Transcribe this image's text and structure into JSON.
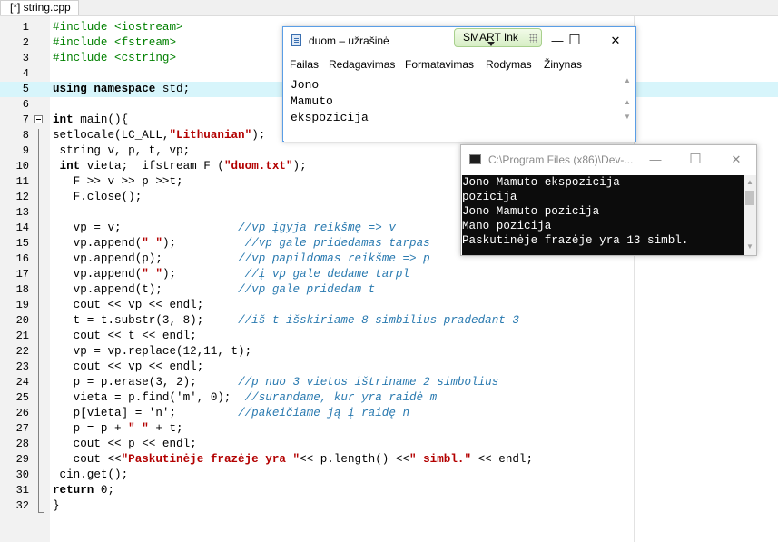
{
  "editor": {
    "tab_label": "[*] string.cpp",
    "lines": [
      {
        "n": "1",
        "segs": [
          {
            "c": "pp",
            "t": "#include <iostream>"
          }
        ]
      },
      {
        "n": "2",
        "segs": [
          {
            "c": "pp",
            "t": "#include <fstream>"
          }
        ]
      },
      {
        "n": "3",
        "segs": [
          {
            "c": "pp",
            "t": "#include <cstring>"
          }
        ]
      },
      {
        "n": "4",
        "segs": []
      },
      {
        "n": "5",
        "hl": true,
        "segs": [
          {
            "c": "kw",
            "t": "using namespace"
          },
          {
            "c": "",
            "t": " std;"
          }
        ]
      },
      {
        "n": "6",
        "segs": []
      },
      {
        "n": "7",
        "fold": true,
        "segs": [
          {
            "c": "kw",
            "t": "int"
          },
          {
            "c": "",
            "t": " main(){"
          }
        ]
      },
      {
        "n": "8",
        "segs": [
          {
            "c": "",
            "t": "setlocale(LC_ALL,"
          },
          {
            "c": "str",
            "t": "\"Lithuanian\""
          },
          {
            "c": "",
            "t": ");"
          }
        ]
      },
      {
        "n": "9",
        "segs": [
          {
            "c": "",
            "t": " string v, p, t, vp;"
          }
        ]
      },
      {
        "n": "10",
        "segs": [
          {
            "c": "",
            "t": " "
          },
          {
            "c": "kw",
            "t": "int"
          },
          {
            "c": "",
            "t": " vieta;  ifstream F ("
          },
          {
            "c": "str",
            "t": "\"duom.txt\""
          },
          {
            "c": "",
            "t": ");"
          }
        ]
      },
      {
        "n": "11",
        "segs": [
          {
            "c": "",
            "t": "   F >> v >> p >>t;"
          }
        ]
      },
      {
        "n": "12",
        "segs": [
          {
            "c": "",
            "t": "   F.close();"
          }
        ]
      },
      {
        "n": "13",
        "segs": []
      },
      {
        "n": "14",
        "segs": [
          {
            "c": "",
            "t": "   vp = v;                 "
          },
          {
            "c": "cmt",
            "t": "//vp įgyja reikšmę => v"
          }
        ]
      },
      {
        "n": "15",
        "segs": [
          {
            "c": "",
            "t": "   vp.append("
          },
          {
            "c": "str",
            "t": "\" \""
          },
          {
            "c": "",
            "t": ");          "
          },
          {
            "c": "cmt",
            "t": "//vp gale pridedamas tarpas"
          }
        ]
      },
      {
        "n": "16",
        "segs": [
          {
            "c": "",
            "t": "   vp.append(p);           "
          },
          {
            "c": "cmt",
            "t": "//vp papildomas reikšme => p"
          }
        ]
      },
      {
        "n": "17",
        "segs": [
          {
            "c": "",
            "t": "   vp.append("
          },
          {
            "c": "str",
            "t": "\" \""
          },
          {
            "c": "",
            "t": ");          "
          },
          {
            "c": "cmt",
            "t": "//į vp gale dedame tarpl"
          }
        ]
      },
      {
        "n": "18",
        "segs": [
          {
            "c": "",
            "t": "   vp.append(t);           "
          },
          {
            "c": "cmt",
            "t": "//vp gale pridedam t"
          }
        ]
      },
      {
        "n": "19",
        "segs": [
          {
            "c": "",
            "t": "   cout << vp << endl;"
          }
        ]
      },
      {
        "n": "20",
        "segs": [
          {
            "c": "",
            "t": "   t = t.substr(3, 8);     "
          },
          {
            "c": "cmt",
            "t": "//iš t išskiriame 8 simbilius pradedant 3"
          }
        ]
      },
      {
        "n": "21",
        "segs": [
          {
            "c": "",
            "t": "   cout << t << endl;"
          }
        ]
      },
      {
        "n": "22",
        "segs": [
          {
            "c": "",
            "t": "   vp = vp.replace(12,11, t);"
          }
        ]
      },
      {
        "n": "23",
        "segs": [
          {
            "c": "",
            "t": "   cout << vp << endl;"
          }
        ]
      },
      {
        "n": "24",
        "segs": [
          {
            "c": "",
            "t": "   p = p.erase(3, 2);      "
          },
          {
            "c": "cmt",
            "t": "//p nuo 3 vietos ištriname 2 simbolius"
          }
        ]
      },
      {
        "n": "25",
        "segs": [
          {
            "c": "",
            "t": "   vieta = p.find('m', 0);  "
          },
          {
            "c": "cmt",
            "t": "//surandame, kur yra raidė m"
          }
        ]
      },
      {
        "n": "26",
        "segs": [
          {
            "c": "",
            "t": "   p[vieta] = 'n';         "
          },
          {
            "c": "cmt",
            "t": "//pakeičiame ją į raidę n"
          }
        ]
      },
      {
        "n": "27",
        "segs": [
          {
            "c": "",
            "t": "   p = p + "
          },
          {
            "c": "str",
            "t": "\" \""
          },
          {
            "c": "",
            "t": " + t;"
          }
        ]
      },
      {
        "n": "28",
        "segs": [
          {
            "c": "",
            "t": "   cout << p << endl;"
          }
        ]
      },
      {
        "n": "29",
        "segs": [
          {
            "c": "",
            "t": "   cout <<"
          },
          {
            "c": "str",
            "t": "\"Paskutinėje frazėje yra \""
          },
          {
            "c": "",
            "t": "<< p.length() <<"
          },
          {
            "c": "str",
            "t": "\" simbl.\""
          },
          {
            "c": "",
            "t": " << endl;"
          }
        ]
      },
      {
        "n": "30",
        "segs": [
          {
            "c": "",
            "t": " cin.get();"
          }
        ]
      },
      {
        "n": "31",
        "segs": [
          {
            "c": "kw",
            "t": "return"
          },
          {
            "c": "",
            "t": " 0;"
          }
        ]
      },
      {
        "n": "32",
        "segs": [
          {
            "c": "",
            "t": "}"
          }
        ]
      }
    ]
  },
  "notepad": {
    "title": "duom – užrašinė",
    "smart_ink": "SMART Ink",
    "minimize": "—",
    "maximize": "☐",
    "close": "✕",
    "menu": [
      "Failas",
      "Redagavimas",
      "Formatavimas",
      "Rodymas",
      "Žinynas"
    ],
    "content": [
      "Jono",
      "Mamuto",
      "ekspozicija"
    ]
  },
  "console": {
    "title": "C:\\Program Files (x86)\\Dev-...",
    "minimize": "—",
    "maximize": "☐",
    "close": "✕",
    "output": [
      "Jono Mamuto ekspozicija",
      "pozicija",
      "Jono Mamuto pozicija",
      "Mano pozicija",
      "Paskutinėje frazėje yra 13 simbl."
    ]
  }
}
